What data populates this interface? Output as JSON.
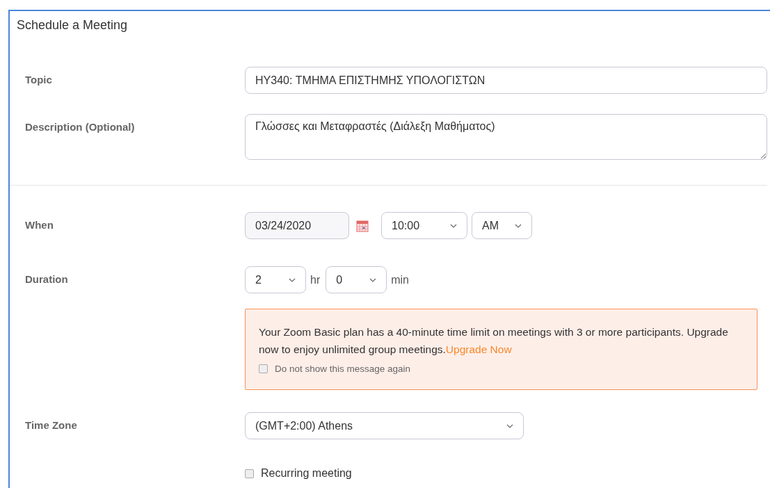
{
  "panel": {
    "title": "Schedule a Meeting"
  },
  "topic": {
    "label": "Topic",
    "value": "HY340: ΤΜΗΜΑ ΕΠΙΣΤΗΜΗΣ ΥΠΟΛΟΓΙΣΤΩΝ"
  },
  "description": {
    "label": "Description (Optional)",
    "value": "Γλώσσες και Μεταφραστές (Διάλεξη Μαθήματος)"
  },
  "when": {
    "label": "When",
    "date": "03/24/2020",
    "time": "10:00",
    "ampm": "AM"
  },
  "duration": {
    "label": "Duration",
    "hours": "2",
    "hours_unit": "hr",
    "minutes": "0",
    "minutes_unit": "min"
  },
  "notice": {
    "text": "Your Zoom Basic plan has a 40-minute time limit on meetings with 3 or more participants. Upgrade now to enjoy unlimited group meetings.",
    "link": "Upgrade Now",
    "dismiss_label": "Do not show this message again",
    "dismiss_checked": false
  },
  "time_zone": {
    "label": "Time Zone",
    "value": "(GMT+2:00) Athens"
  },
  "recurring": {
    "label": "Recurring meeting",
    "checked": false
  }
}
